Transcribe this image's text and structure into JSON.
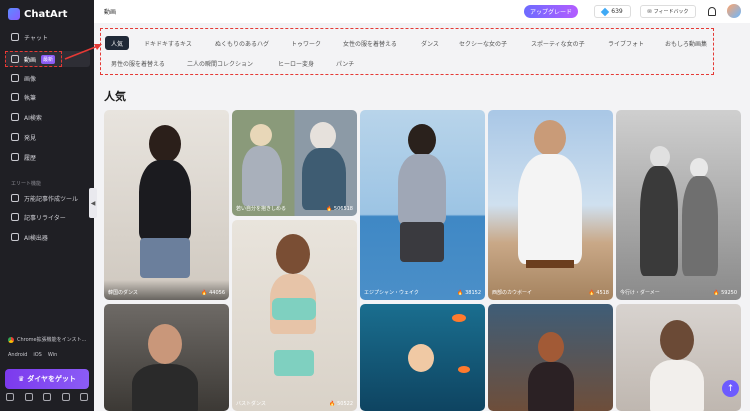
{
  "app": {
    "name": "ChatArt"
  },
  "sidebar": {
    "items": [
      {
        "label": "チャット"
      },
      {
        "label": "動画",
        "badge": "最新"
      },
      {
        "label": "画像"
      },
      {
        "label": "執筆"
      },
      {
        "label": "AI検索"
      },
      {
        "label": "発見"
      },
      {
        "label": "履歴"
      }
    ],
    "section_title": "エリート機能",
    "elite_items": [
      {
        "label": "万能記事作成ツール"
      },
      {
        "label": "記事リライター"
      },
      {
        "label": "AI検出器"
      }
    ],
    "extension_text": "Chrome拡張機能をインスト...",
    "platforms": [
      "Android",
      "iOS",
      "Win"
    ],
    "diamond_button": "ダイヤをゲット"
  },
  "topbar": {
    "title": "動画",
    "upgrade": "アップグレード",
    "gems": "639",
    "feedback": "フィードバック"
  },
  "categories": [
    "人気",
    "ドキドキするキス",
    "ぬくもりのあるハグ",
    "トゥワーク",
    "女性の服を着替える",
    "ダンス",
    "セクシーな女の子",
    "スポーティな女の子",
    "ライブフォト",
    "おもしろ動画集",
    "男性の服を着替える",
    "二人の瞬間コレクション",
    "ヒーロー変身",
    "パンチ"
  ],
  "section_heading": "人気",
  "cards": [
    {
      "caption": "韓国のダンス",
      "likes": "44056"
    },
    {
      "caption": "若い自分を抱きしめる",
      "likes": "506518"
    },
    {
      "caption": "エジプシャン・ウェイク",
      "likes": "38152"
    },
    {
      "caption": "西部のカウボーイ",
      "likes": "4518"
    },
    {
      "caption": "今行け・ダーメー",
      "likes": "59250"
    },
    {
      "caption": "バストダンス",
      "likes": "50522"
    }
  ],
  "colors": {
    "accent": "#8b5cf6",
    "highlight": "#e53935",
    "sidebar_bg": "#1f1f24"
  }
}
